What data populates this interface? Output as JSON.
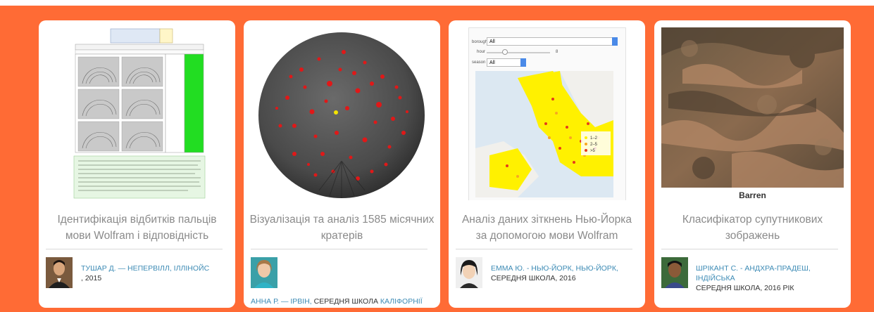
{
  "cards": [
    {
      "title_line1": "Ідентифікація відбитків пальців",
      "title_line2": "мови Wolfram і відповідність",
      "author_name": "ТУШАР Д. — НЕПЕРВІЛЛ, ІЛЛІНОЙС",
      "author_rest": ", 2015",
      "thumb_icon": "fingerprint-table-image"
    },
    {
      "title_line1": "Візуалізація та аналіз 1585 місячних",
      "title_line2": "кратерів",
      "author_name": "АННА Р. — ІРВІН,",
      "author_mid": " СЕРЕДНЯ ШКОЛА ",
      "author_tail": "КАЛІФОРНІЇ",
      "thumb_icon": "moon-craters-image"
    },
    {
      "title_line1": "Аналіз даних зіткнень Нью-Йорка",
      "title_line2": "за допомогою мови Wolfram",
      "author_name": "ЕММА Ю. - НЬЮ-ЙОРК, НЬЮ-ЙОРК,",
      "author_rest": "СЕРЕДНЯ ШКОЛА, 2016",
      "thumb_icon": "nyc-collision-map-image",
      "controls": {
        "borough_label": "borough",
        "borough_value": "All",
        "hour_label": "hour",
        "hour_value": "8",
        "season_label": "season",
        "season_value": "All",
        "legend": [
          "1–2",
          "2–5",
          ">5"
        ]
      }
    },
    {
      "title_line1": "Класифікатор супутникових",
      "title_line2": "зображень",
      "author_name": "ШРІКАНТ С. - АНДХРА-ПРАДЕШ, ІНДІЙСЬКА",
      "author_rest": "СЕРЕДНЯ ШКОЛА, 2016 РІК",
      "thumb_icon": "satellite-terrain-image",
      "image_label": "Barren"
    }
  ],
  "colors": {
    "accent": "#ff6b35",
    "link": "#3d8bb5",
    "title": "#8a8a8a"
  }
}
